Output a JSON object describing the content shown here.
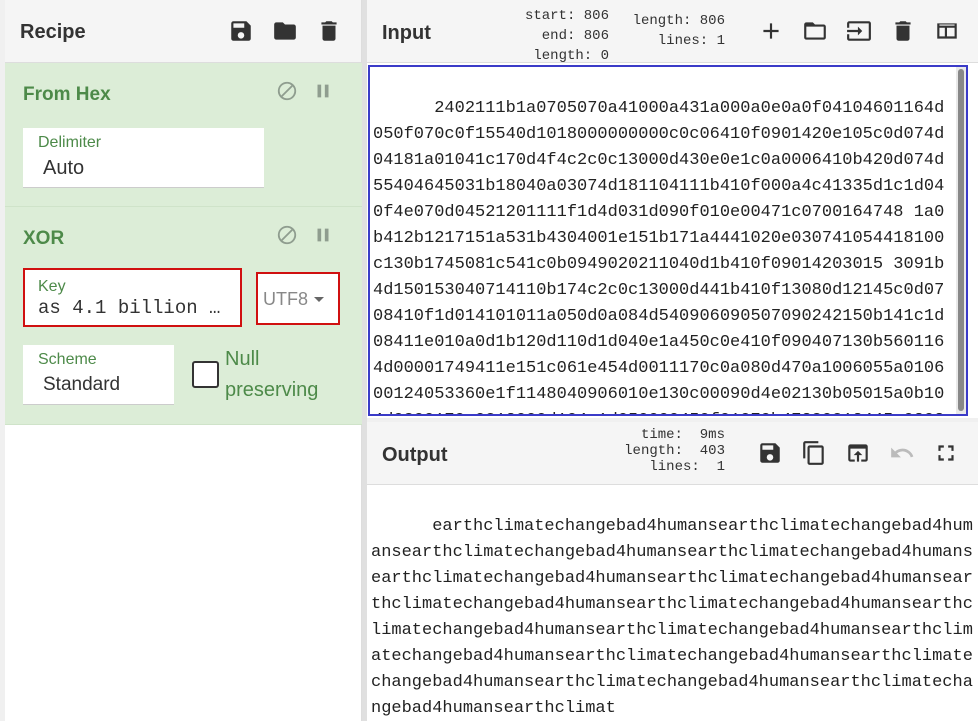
{
  "recipe": {
    "title": "Recipe",
    "ops": [
      {
        "title": "From Hex",
        "delimiter_label": "Delimiter",
        "delimiter_value": "Auto"
      },
      {
        "title": "XOR",
        "key_label": "Key",
        "key_value": "as 4.1 billion …",
        "key_encoding": "UTF8",
        "scheme_label": "Scheme",
        "scheme_value": "Standard",
        "null_label": "Null preserving"
      }
    ]
  },
  "input": {
    "title": "Input",
    "stats": {
      "start": "806",
      "end": "806",
      "length_sel": "0",
      "length": "806",
      "lines": "1"
    },
    "stat_labels": {
      "start": "start:",
      "end": "end:",
      "length": "length:",
      "lines": "lines:"
    },
    "text": "2402111b1a0705070a41000a431a000a0e0a0f04104601164d050f070c0f15540d1018000000000c0c06410f0901420e105c0d074d04181a01041c170d4f4c2c0c13000d430e0e1c0a0006410b420d074d55404645031b18040a03074d181104111b410f000a4c41335d1c1d040f4e070d04521201111f1d4d031d090f010e00471c0700164748 1a0b412b1217151a531b4304001e151b171a4441020e030741054418100c130b1745081c541c0b0949020211040d1b410f09014203015 3091b4d150153040714110b174c2c0c13000d441b410f13080d12145c0d0708410f1d014101011a050d0a084d540906090507090242150b141c1d08411e010a0d1b120d110d1d040e1a450c0e410f090407130b5601164d00001749411e151c061e454d0011170c0a080d470a1006055a010600124053360e1f1148040906010e130c00090d4e02130b05015a0b104d0800170c0213000d104c1d050000450f01070b47380213445a030303410f010c10171e48081f4303000001a40"
  },
  "output": {
    "title": "Output",
    "stats": {
      "time": "9ms",
      "length": "403",
      "lines": "1"
    },
    "stat_labels": {
      "time": "time:",
      "length": "length:",
      "lines": "lines:"
    },
    "text": "earthclimatechangebad4humansearthclimatechangebad4humansearthclimatechangebad4humansearthclimatechangebad4humansearthclimatechangebad4humansearthclimatechangebad4humansearthclimatechangebad4humansearthclimatechangebad4humansearthclimatechangebad4humansearthclimatechangebad4humansearthclimatechangebad4humansearthclimatechangebad4humansearthclimatechangebad4humansearthclimatechangebad4humansearthclimatechangebad4humansearthclimat"
  }
}
